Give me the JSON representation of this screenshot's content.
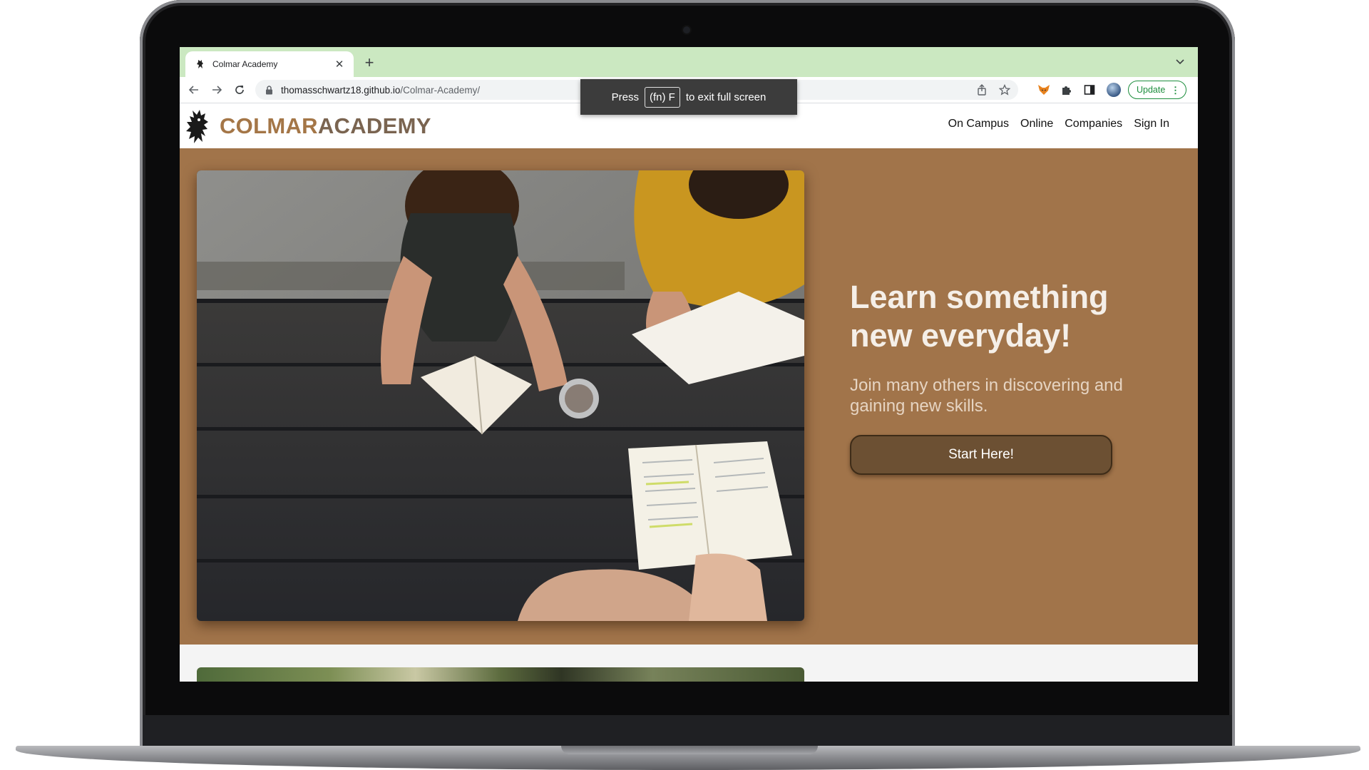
{
  "browser": {
    "tab_title": "Colmar Academy",
    "new_tab_label": "+",
    "tab_close_label": "✕",
    "url_host": "thomasschwartz18.github.io",
    "url_path": "/Colmar-Academy/",
    "update_label": "Update",
    "update_menu": "⋮"
  },
  "fullscreen_toast": {
    "press": "Press",
    "key": "(fn) F",
    "rest": "to exit full screen"
  },
  "site": {
    "brand_part1": "COLMAR",
    "brand_part2": "ACADEMY",
    "nav": [
      "On Campus",
      "Online",
      "Companies",
      "Sign In"
    ],
    "hero": {
      "headline": "Learn something new everyday!",
      "subtext": "Join many others in discovering and gaining new skills.",
      "cta": "Start Here!"
    }
  },
  "colors": {
    "tabstrip": "#cbe8c1",
    "hero_bg": "#a1744a",
    "brand_primary": "#a47647",
    "brand_secondary": "#7a6450",
    "cta_bg": "#6c5033",
    "update_green": "#1e8e3e"
  },
  "icons": {
    "favicon": "griffin-icon",
    "back": "back-arrow-icon",
    "forward": "forward-arrow-icon",
    "reload": "reload-icon",
    "lock": "lock-icon",
    "share": "share-icon",
    "bookmark": "star-icon",
    "extension1": "fox-extension-icon",
    "extensions": "puzzle-icon",
    "side_panel": "side-panel-icon",
    "profile": "profile-avatar",
    "tab_list": "chevron-down-icon",
    "logo": "griffin-logo-icon"
  }
}
